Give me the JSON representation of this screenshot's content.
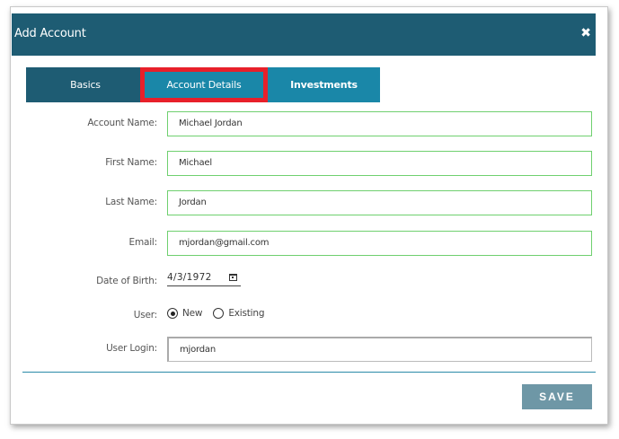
{
  "dialog": {
    "title": "Add Account",
    "close_symbol": "✖"
  },
  "tabs": [
    {
      "label": "Basics",
      "active": false
    },
    {
      "label": "Account Details",
      "active": true,
      "highlighted": true
    },
    {
      "label": "Investments",
      "active": false
    }
  ],
  "form": {
    "account_name": {
      "label": "Account Name:",
      "value": "Michael Jordan"
    },
    "first_name": {
      "label": "First Name:",
      "value": "Michael"
    },
    "last_name": {
      "label": "Last Name:",
      "value": "Jordan"
    },
    "email": {
      "label": "Email:",
      "value": "mjordan@gmail.com"
    },
    "date_of_birth": {
      "label": "Date of Birth:",
      "value": "4/3/1972"
    },
    "user": {
      "label": "User:",
      "options": [
        {
          "label": "New",
          "checked": true
        },
        {
          "label": "Existing",
          "checked": false
        }
      ]
    },
    "user_login": {
      "label": "User Login:",
      "value": "mjordan"
    }
  },
  "actions": {
    "save_label": "SAVE"
  },
  "colors": {
    "header": "#1e5c73",
    "tab_active": "#1a87a8",
    "highlight": "#e8202a",
    "field_border": "#6fd06f",
    "save_button": "#6e97a6"
  }
}
